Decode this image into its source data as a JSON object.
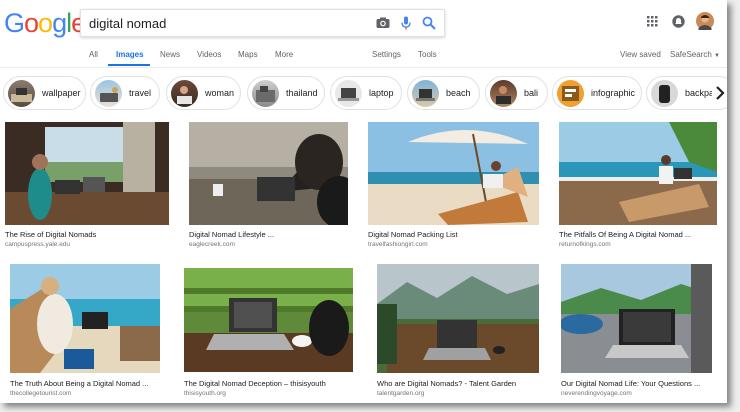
{
  "search": {
    "query": "digital nomad"
  },
  "nav": {
    "tabs": [
      "All",
      "Images",
      "News",
      "Videos",
      "Maps",
      "More"
    ],
    "active_tab": "Images",
    "settings": "Settings",
    "tools": "Tools",
    "view_saved": "View saved",
    "safesearch": "SafeSearch"
  },
  "chips": [
    "wallpaper",
    "travel",
    "woman",
    "thailand",
    "laptop",
    "beach",
    "bali",
    "infographic",
    "backpa"
  ],
  "results": [
    {
      "title": "The Rise of Digital Nomads",
      "source": "campuspress.yale.edu"
    },
    {
      "title": "Digital Nomad Lifestyle ...",
      "source": "eaglecreek.com"
    },
    {
      "title": "Digital Nomad Packing List",
      "source": "travelfashiongirl.com"
    },
    {
      "title": "The Pitfalls Of Being A Digital Nomad ...",
      "source": "returnofkings.com"
    },
    {
      "title": "The Truth About Being a Digital Nomad ...",
      "source": "thecollegetourist.com"
    },
    {
      "title": "The Digital Nomad Deception – thisisyouth",
      "source": "thisisyouth.org"
    },
    {
      "title": "Who are Digital Nomads? - Talent Garden",
      "source": "talentgarden.org"
    },
    {
      "title": "Our Digital Nomad Life: Your Questions ...",
      "source": "neverendingvoyage.com"
    }
  ],
  "colors": {
    "blue": "#4285F4",
    "red": "#EA4335",
    "yellow": "#FBBC05",
    "green": "#34A853",
    "active": "#1a73e8"
  },
  "icons": [
    "camera-icon",
    "microphone-icon",
    "search-icon",
    "apps-grid-icon",
    "notifications-icon",
    "avatar"
  ]
}
